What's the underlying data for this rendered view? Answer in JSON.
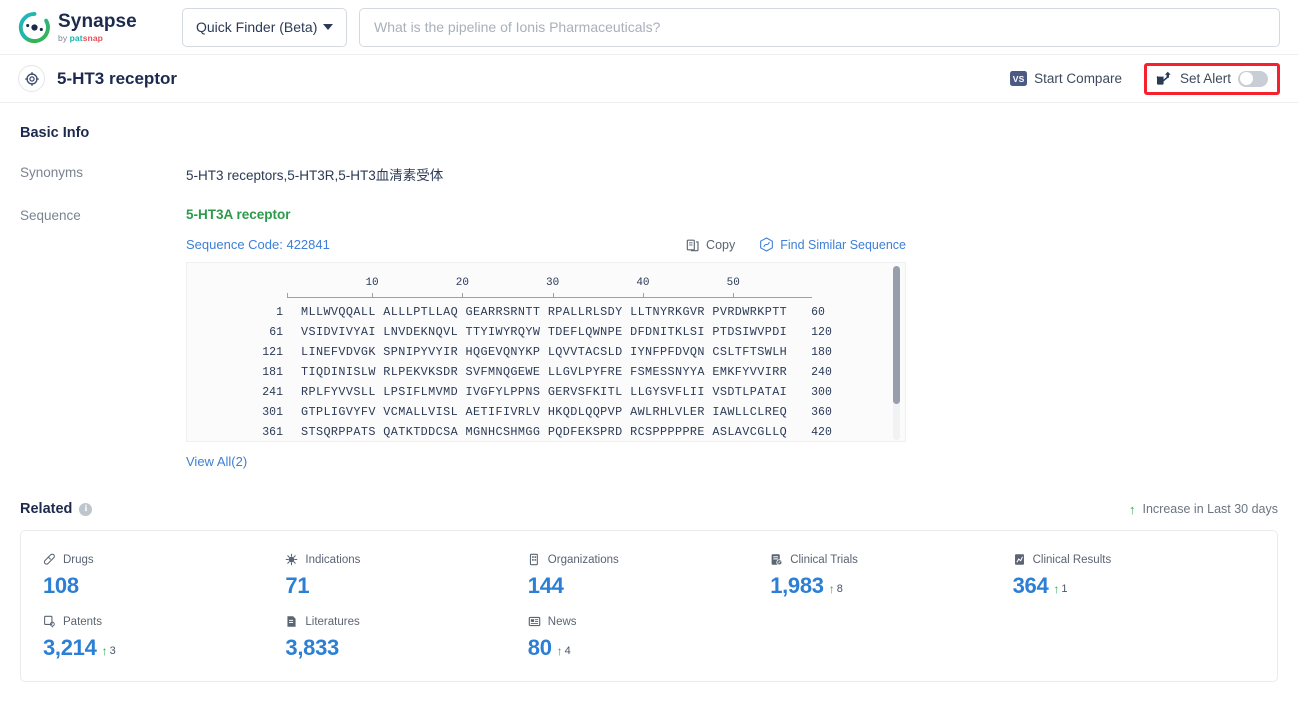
{
  "brand": {
    "name": "Synapse",
    "tagline_prefix": "by ",
    "tagline_pat": "pat",
    "tagline_snap": "snap"
  },
  "topbar": {
    "finder_label": "Quick Finder (Beta)",
    "search_placeholder": "What is the pipeline of Ionis Pharmaceuticals?",
    "search_value": ""
  },
  "titlebar": {
    "title": "5-HT3 receptor",
    "compare_label": "Start Compare",
    "vs_badge": "VS",
    "alert_label": "Set Alert",
    "alert_on": false
  },
  "basic_info": {
    "heading": "Basic Info",
    "rows": [
      {
        "label": "Synonyms",
        "value": "5-HT3 receptors,5-HT3R,5-HT3血清素受体"
      },
      {
        "label": "Sequence",
        "value": ""
      }
    ]
  },
  "sequence": {
    "name": "5-HT3A receptor",
    "code_label": "Sequence Code: 422841",
    "copy_label": "Copy",
    "find_similar_label": "Find Similar Sequence",
    "view_all_label": "View All(2)",
    "ruler_ticks": [
      10,
      20,
      30,
      40,
      50
    ],
    "rows": [
      {
        "start": "1",
        "chunks": "MLLWVQQALL ALLLPTLLAQ GEARRSRNTT RPALLRLSDY LLTNYRKGVR PVRDWRKPTT",
        "end": "60"
      },
      {
        "start": "61",
        "chunks": "VSIDVIVYAI LNVDEKNQVL TTYIWYRQYW TDEFLQWNPE DFDNITKLSI PTDSIWVPDI",
        "end": "120"
      },
      {
        "start": "121",
        "chunks": "LINEFVDVGK SPNIPYVYIR HQGEVQNYKP LQVVTACSLD IYNFPFDVQN CSLTFTSWLH",
        "end": "180"
      },
      {
        "start": "181",
        "chunks": "TIQDINISLW RLPEKVKSDR SVFMNQGEWE LLGVLPYFRE FSMESSNYYA EMKFYVVIRR",
        "end": "240"
      },
      {
        "start": "241",
        "chunks": "RPLFYVVSLL LPSIFLMVMD IVGFYLPPNS GERVSFKITL LLGYSVFLII VSDTLPATAI",
        "end": "300"
      },
      {
        "start": "301",
        "chunks": "GTPLIGVYFV VCMALLVISL AETIFIVRLV HKQDLQQPVP AWLRHLVLER IAWLLCLREQ",
        "end": "360"
      },
      {
        "start": "361",
        "chunks": "STSQRPPATS QATKTDDCSA MGNHCSHMGG PQDFEKSPRD RCSPPPPPRE ASLAVCGLLQ",
        "end": "420"
      }
    ]
  },
  "related": {
    "heading": "Related",
    "legend_label": "Increase in Last 30 days",
    "stats": [
      {
        "icon": "capsule-icon",
        "label": "Drugs",
        "value": "108",
        "delta": ""
      },
      {
        "icon": "virus-icon",
        "label": "Indications",
        "value": "71",
        "delta": ""
      },
      {
        "icon": "building-icon",
        "label": "Organizations",
        "value": "144",
        "delta": ""
      },
      {
        "icon": "clinical-trial-icon",
        "label": "Clinical Trials",
        "value": "1,983",
        "delta": "8"
      },
      {
        "icon": "clinical-result-icon",
        "label": "Clinical Results",
        "value": "364",
        "delta": "1"
      },
      {
        "icon": "patent-icon",
        "label": "Patents",
        "value": "3,214",
        "delta": "3"
      },
      {
        "icon": "literature-icon",
        "label": "Literatures",
        "value": "3,833",
        "delta": ""
      },
      {
        "icon": "news-icon",
        "label": "News",
        "value": "80",
        "delta": "4"
      }
    ]
  },
  "colors": {
    "brand_blue": "#2b7fd4",
    "link_blue": "#3d7fd6",
    "green": "#2fa84f",
    "seq_green": "#2c9a4a",
    "alert_red": "#f5222d"
  }
}
